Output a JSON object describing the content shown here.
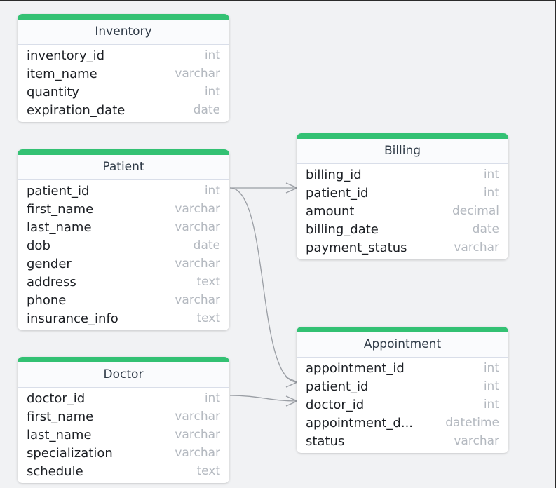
{
  "tables": {
    "inventory": {
      "title": "Inventory",
      "fields": [
        {
          "name": "inventory_id",
          "type": "int"
        },
        {
          "name": "item_name",
          "type": "varchar"
        },
        {
          "name": "quantity",
          "type": "int"
        },
        {
          "name": "expiration_date",
          "type": "date"
        }
      ]
    },
    "patient": {
      "title": "Patient",
      "fields": [
        {
          "name": "patient_id",
          "type": "int"
        },
        {
          "name": "first_name",
          "type": "varchar"
        },
        {
          "name": "last_name",
          "type": "varchar"
        },
        {
          "name": "dob",
          "type": "date"
        },
        {
          "name": "gender",
          "type": "varchar"
        },
        {
          "name": "address",
          "type": "text"
        },
        {
          "name": "phone",
          "type": "varchar"
        },
        {
          "name": "insurance_info",
          "type": "text"
        }
      ]
    },
    "doctor": {
      "title": "Doctor",
      "fields": [
        {
          "name": "doctor_id",
          "type": "int"
        },
        {
          "name": "first_name",
          "type": "varchar"
        },
        {
          "name": "last_name",
          "type": "varchar"
        },
        {
          "name": "specialization",
          "type": "varchar"
        },
        {
          "name": "schedule",
          "type": "text"
        }
      ]
    },
    "billing": {
      "title": "Billing",
      "fields": [
        {
          "name": "billing_id",
          "type": "int"
        },
        {
          "name": "patient_id",
          "type": "int"
        },
        {
          "name": "amount",
          "type": "decimal"
        },
        {
          "name": "billing_date",
          "type": "date"
        },
        {
          "name": "payment_status",
          "type": "varchar"
        }
      ]
    },
    "appointment": {
      "title": "Appointment",
      "fields": [
        {
          "name": "appointment_id",
          "type": "int"
        },
        {
          "name": "patient_id",
          "type": "int"
        },
        {
          "name": "doctor_id",
          "type": "int"
        },
        {
          "name": "appointment_d...",
          "type": "datetime"
        },
        {
          "name": "status",
          "type": "varchar"
        }
      ]
    }
  },
  "relations": [
    {
      "from": "patient.patient_id",
      "to": "billing.patient_id",
      "cardinality": "one-to-many"
    },
    {
      "from": "patient.patient_id",
      "to": "appointment.patient_id",
      "cardinality": "one-to-many"
    },
    {
      "from": "doctor.doctor_id",
      "to": "appointment.doctor_id",
      "cardinality": "one-to-many"
    }
  ],
  "colors": {
    "header_accent": "#33c173",
    "connector": "#9a9ea4",
    "background": "#f1f2f4"
  }
}
